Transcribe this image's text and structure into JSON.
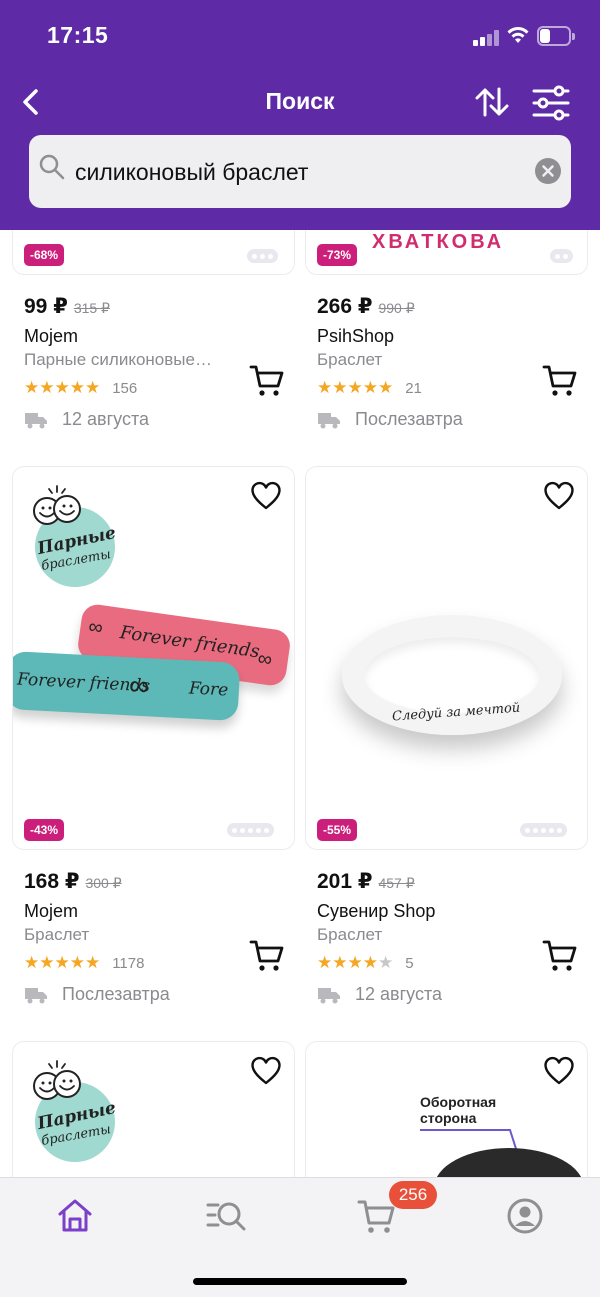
{
  "status_bar": {
    "time": "17:15"
  },
  "nav": {
    "title": "Поиск"
  },
  "search": {
    "value": "силиконовый браслет",
    "placeholder": ""
  },
  "colors": {
    "header": "#5f2aa6",
    "discount_badge": "#cb1f7b",
    "star": "#f5a623",
    "cart_badge": "#e8503a",
    "active_tab": "#7b3fc9"
  },
  "products": [
    {
      "discount": "-68%",
      "price": "99 ₽",
      "old_price": "315 ₽",
      "brand": "Mojem",
      "name": "Парные силиконовые…",
      "rating": 5,
      "reviews": "156",
      "delivery": "12 августа"
    },
    {
      "discount": "-73%",
      "image_text": "ХВАТКОВА",
      "price": "266 ₽",
      "old_price": "990 ₽",
      "brand": "PsihShop",
      "name": "Браслет",
      "rating": 5,
      "reviews": "21",
      "delivery": "Послезавтра"
    },
    {
      "discount": "-43%",
      "logo_line1": "Парные",
      "logo_line2": "браслеты",
      "band_text": "Forever friends",
      "price": "168 ₽",
      "old_price": "300 ₽",
      "brand": "Mojem",
      "name": "Браслет",
      "rating": 5,
      "reviews": "1178",
      "delivery": "Послезавтра"
    },
    {
      "discount": "-55%",
      "band_text": "Следуй за мечтой",
      "price": "201 ₽",
      "old_price": "457 ₽",
      "brand": "Сувенир Shop",
      "name": "Браслет",
      "rating": 4,
      "reviews": "5",
      "delivery": "12 августа"
    },
    {
      "logo_line1": "Парные",
      "logo_line2": "браслеты"
    },
    {
      "image_text_line1": "Оборотная",
      "image_text_line2": "сторона"
    }
  ],
  "tabbar": {
    "tabs": [
      {
        "name": "home",
        "icon": "home-icon",
        "active": true
      },
      {
        "name": "catalog",
        "icon": "catalog-search-icon",
        "active": false
      },
      {
        "name": "cart",
        "icon": "cart-icon",
        "active": false
      },
      {
        "name": "profile",
        "icon": "profile-icon",
        "active": false
      }
    ],
    "cart_count": "256"
  }
}
